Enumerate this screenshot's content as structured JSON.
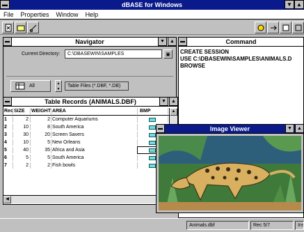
{
  "app": {
    "title": "dBASE for Windows"
  },
  "menu": [
    {
      "label": "File"
    },
    {
      "label": "Properties"
    },
    {
      "label": "Window"
    },
    {
      "label": "Help"
    }
  ],
  "navigator": {
    "title": "Navigator",
    "current_directory_label": "Current Directory:",
    "current_directory_value": "C:\\DBASEWIN\\SAMPLES",
    "category_label": "All",
    "file_type_value": "Table Files (*.DBF, *.DB)"
  },
  "command": {
    "title": "Command",
    "lines": "CREATE SESSION\nUSE C:\\DBASEWIN\\SAMPLES\\ANIMALS.D\nBROWSE"
  },
  "table": {
    "title": "Table Records (ANIMALS.DBF)",
    "columns": [
      "Rec",
      "SIZE",
      "WEIGHT",
      "AREA",
      "BMP"
    ],
    "rows": [
      {
        "rec": "1",
        "size": "2",
        "weight": "2",
        "area": "Computer Aquariums"
      },
      {
        "rec": "2",
        "size": "10",
        "weight": "8",
        "area": "South America"
      },
      {
        "rec": "3",
        "size": "30",
        "weight": "20",
        "area": "Screen Savers"
      },
      {
        "rec": "4",
        "size": "10",
        "weight": "5",
        "area": "New Orleans"
      },
      {
        "rec": "5",
        "size": "40",
        "weight": "35",
        "area": "Africa and Asia"
      },
      {
        "rec": "6",
        "size": "5",
        "weight": "5",
        "area": "South America"
      },
      {
        "rec": "7",
        "size": "2",
        "weight": "2",
        "area": "Fish bowls"
      }
    ]
  },
  "image_viewer": {
    "title": "Image Viewer"
  },
  "status": {
    "table": "Animals.dbf",
    "record": "Rec 5/7",
    "mode": "Ins"
  },
  "colors": {
    "titlebar": "#0a1a8a",
    "workspace": "#c0c0c0",
    "bmp_icon": "#7fd6d6"
  }
}
